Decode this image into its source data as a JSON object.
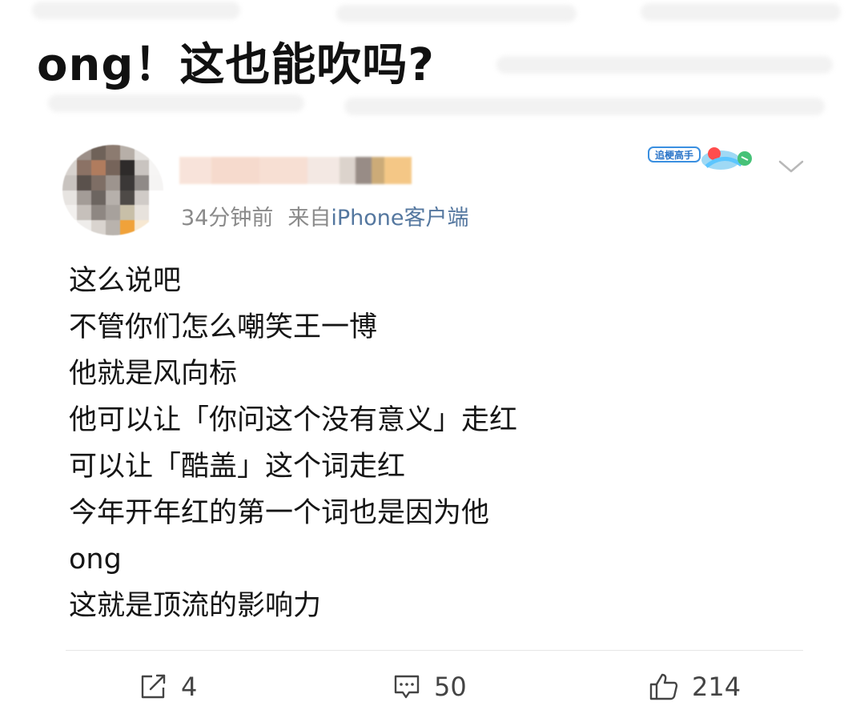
{
  "headline": "ong！这也能吹吗?",
  "post": {
    "time": "34分钟前",
    "source_prefix": "来自",
    "source": "iPhone客户端",
    "lines": [
      "这么说吧",
      "不管你们怎么嘲笑王一博",
      "他就是风向标",
      "他可以让「你问这个没有意义」走红",
      "可以让「酷盖」这个词走红",
      "今年开年红的第一个词也是因为他",
      "ong",
      "这就是顶流的影响力"
    ],
    "badge_text": "追梗高手",
    "actions": {
      "forward_count": "4",
      "comment_count": "50",
      "like_count": "214"
    }
  },
  "colors": {
    "meta_gray": "#8a8a8a",
    "source_blue": "#54779f",
    "text": "#151515",
    "icon": "#444444"
  }
}
